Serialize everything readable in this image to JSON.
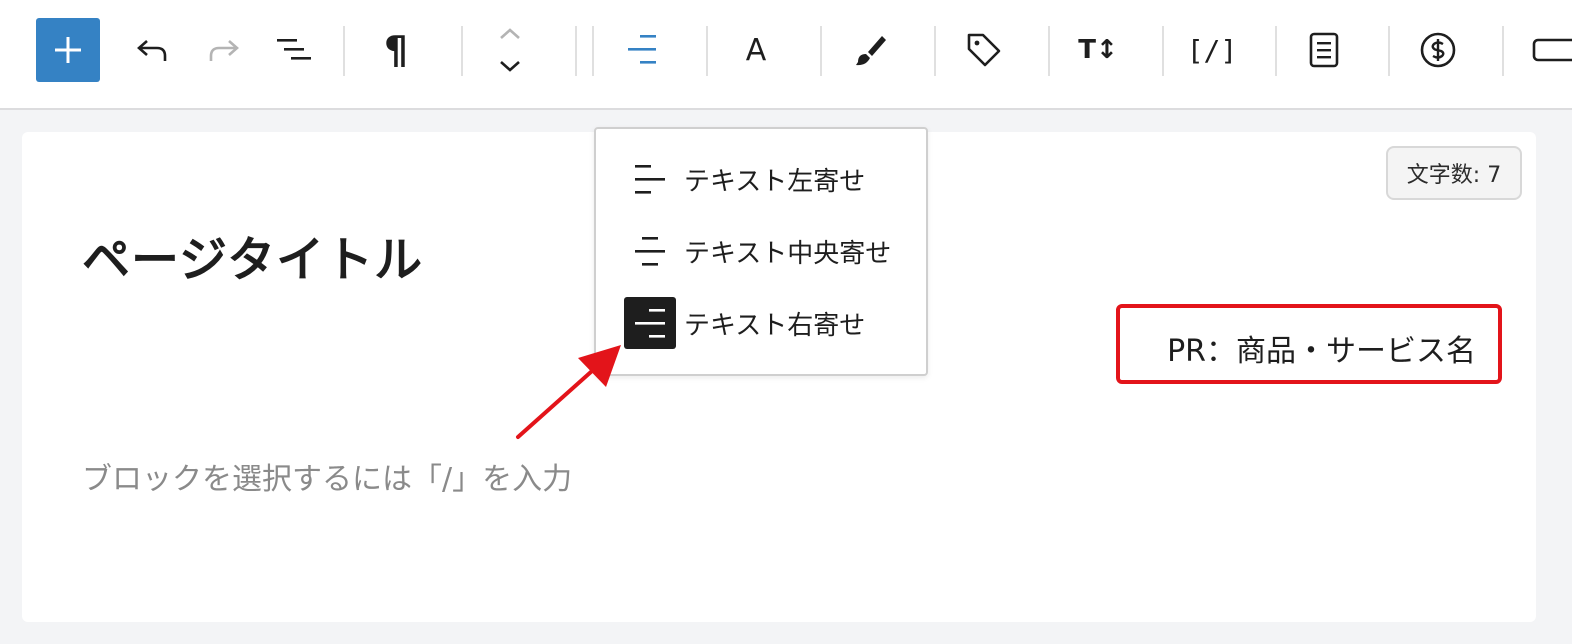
{
  "toolbar": {
    "buttons": [
      {
        "name": "add-block",
        "icon": "plus-icon"
      },
      {
        "name": "undo",
        "icon": "undo-icon"
      },
      {
        "name": "redo",
        "icon": "redo-icon"
      },
      {
        "name": "list-view",
        "icon": "list-view-icon"
      },
      {
        "name": "paragraph",
        "icon": "pilcrow-icon",
        "glyph": "¶"
      },
      {
        "name": "move",
        "icon": "move-up-down-icon"
      },
      {
        "name": "align",
        "icon": "align-right-icon"
      },
      {
        "name": "text-color",
        "icon": "letter-a-icon",
        "glyph": "A"
      },
      {
        "name": "brush",
        "icon": "paintbrush-icon"
      },
      {
        "name": "tag",
        "icon": "tag-icon"
      },
      {
        "name": "font-size",
        "icon": "font-size-icon",
        "glyph": "T↕"
      },
      {
        "name": "shortcode",
        "icon": "shortcode-icon",
        "glyph": "[/]"
      },
      {
        "name": "page",
        "icon": "document-icon"
      },
      {
        "name": "currency",
        "icon": "dollar-circle-icon"
      },
      {
        "name": "button",
        "icon": "button-icon"
      }
    ],
    "accent_color": "#3582c4"
  },
  "align_menu": {
    "items": [
      {
        "label": "テキスト左寄せ",
        "icon": "align-left-icon",
        "selected": false
      },
      {
        "label": "テキスト中央寄せ",
        "icon": "align-center-icon",
        "selected": false
      },
      {
        "label": "テキスト右寄せ",
        "icon": "align-right-icon",
        "selected": true
      }
    ]
  },
  "editor": {
    "title": "ページタイトル",
    "char_count": "文字数: 7",
    "pr_text": "PR：商品・サービス名",
    "placeholder": "ブロックを選択するには「/」を入力"
  },
  "annotation": {
    "highlight_color": "#e3141a"
  }
}
